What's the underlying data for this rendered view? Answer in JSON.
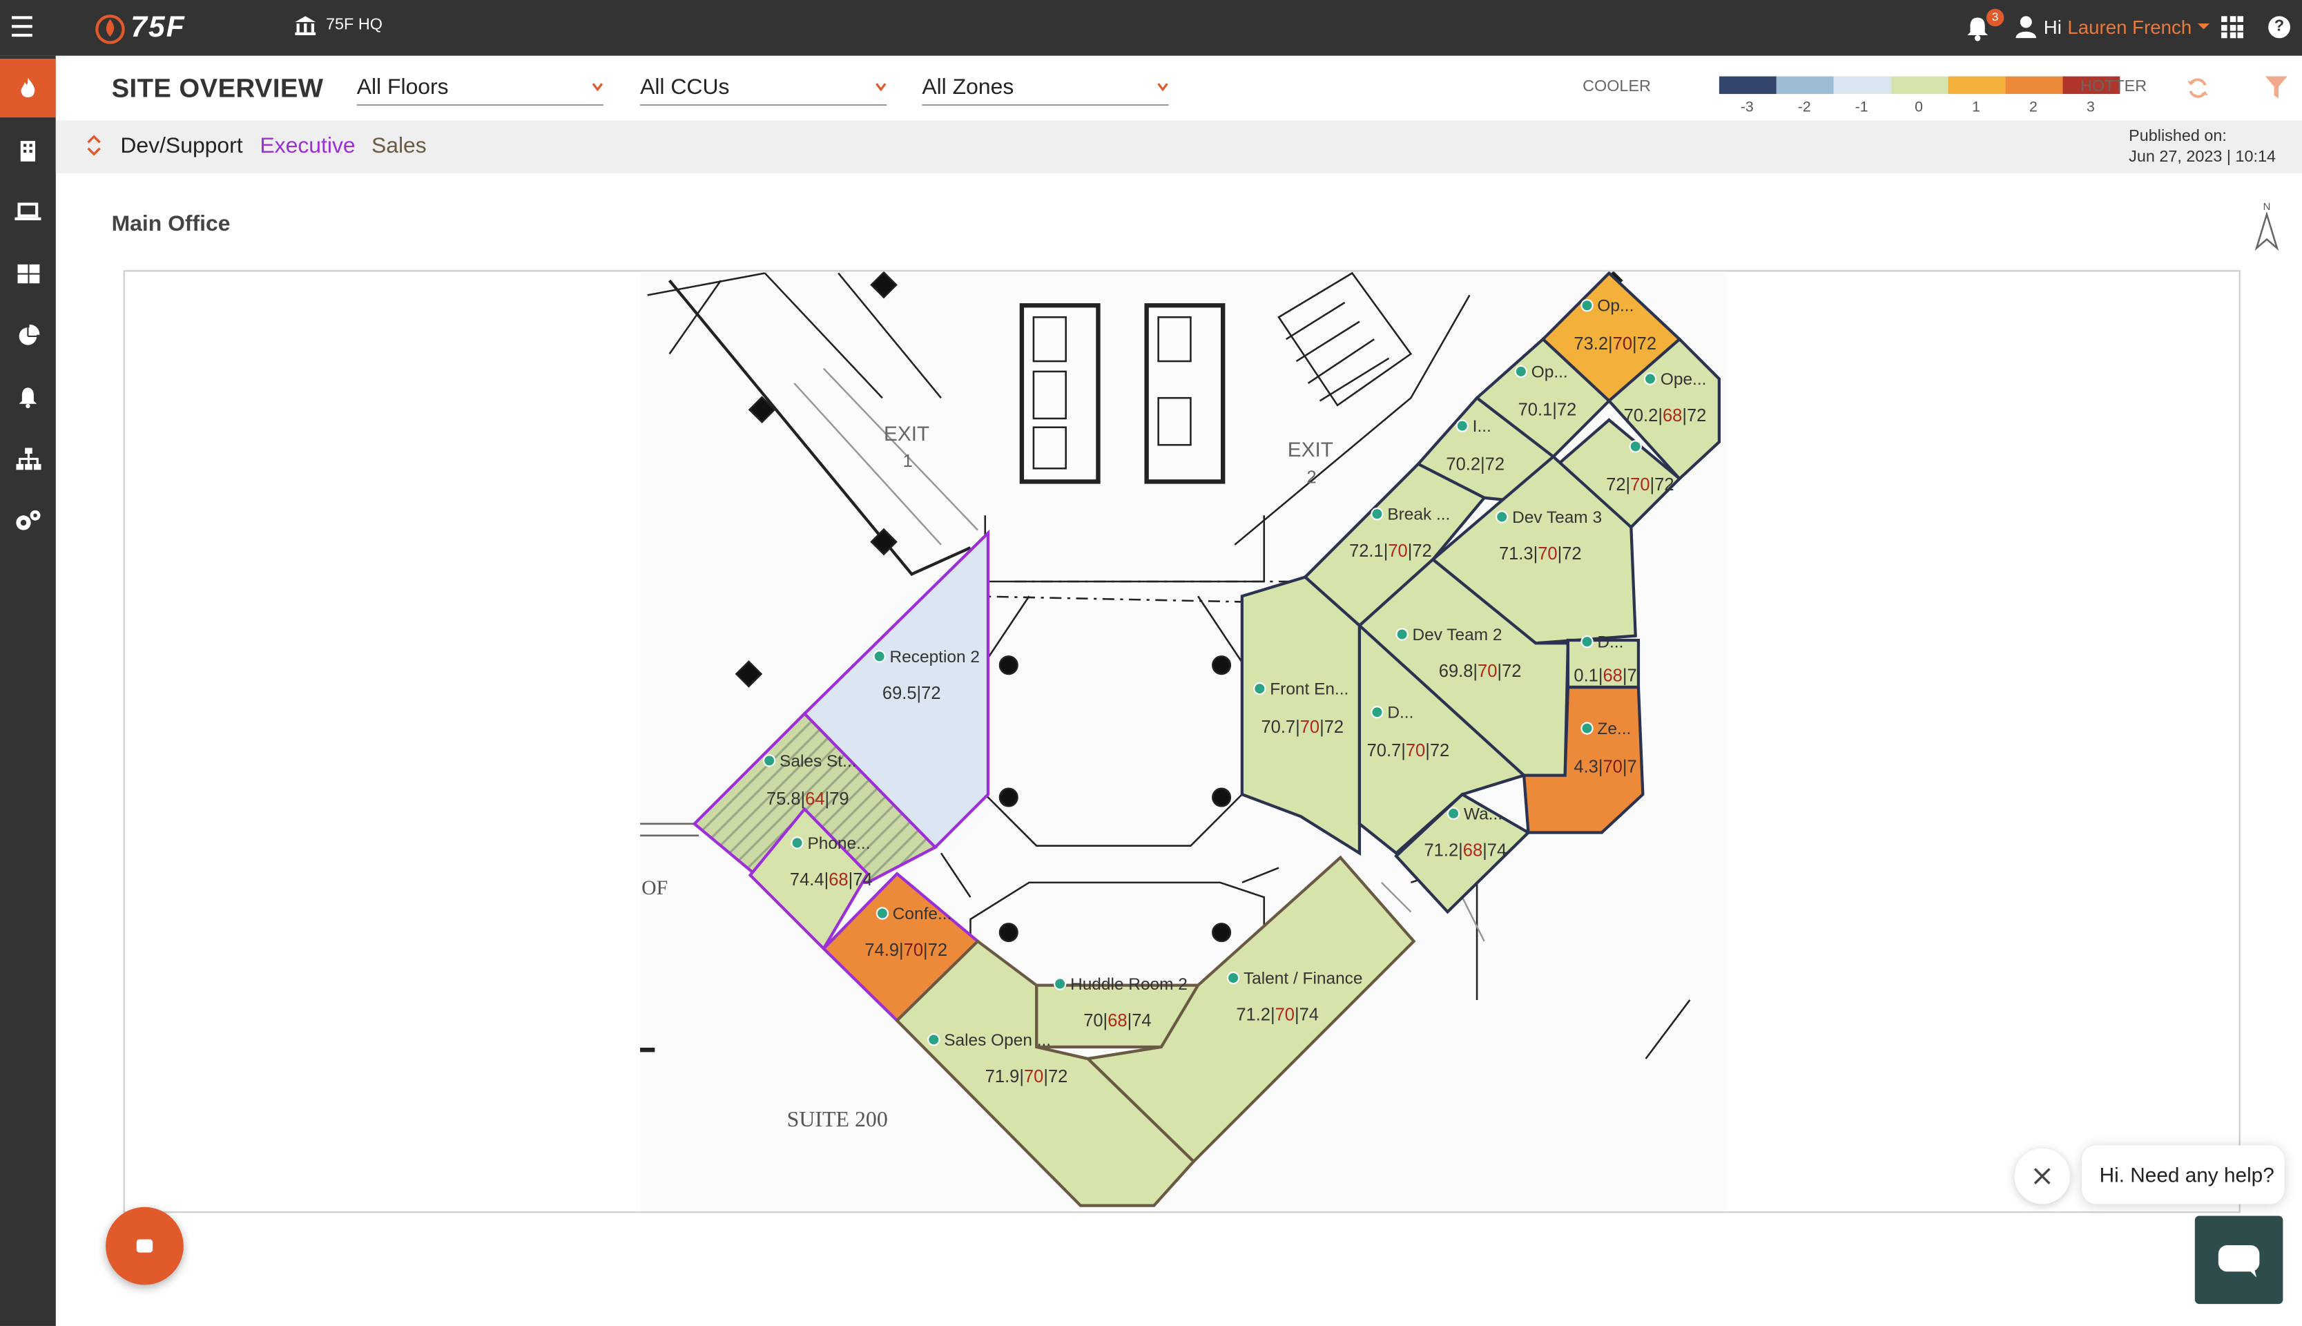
{
  "topbar": {
    "brand": "75F",
    "site_name": "75F HQ",
    "notifications_count": "3",
    "greeting": "Hi",
    "user_name": "Lauren French"
  },
  "header": {
    "title": "SITE OVERVIEW",
    "filters": [
      {
        "label": "All Floors"
      },
      {
        "label": "All CCUs"
      },
      {
        "label": "All Zones"
      }
    ]
  },
  "legend": {
    "cooler_label": "COOLER",
    "hotter_label": "HOTTER",
    "ticks": [
      "-3",
      "-2",
      "-1",
      "0",
      "1",
      "2",
      "3"
    ],
    "colors": [
      "#34456b",
      "#9dbcd6",
      "#d9e6f2",
      "#d6e4ab",
      "#f3b13c",
      "#ec8a3a",
      "#b0362c"
    ]
  },
  "subbar": {
    "tabs": [
      {
        "label": "Dev/Support",
        "color": "#222222"
      },
      {
        "label": "Executive",
        "color": "#9b30d9"
      },
      {
        "label": "Sales",
        "color": "#6b5a43"
      }
    ],
    "published_label": "Published on:",
    "published_date": "Jun 27, 2023 | 10:14"
  },
  "floor": {
    "name": "Main Office",
    "compass": "N",
    "suite_label": "SUITE 200",
    "exit1": "EXIT",
    "exit1_num": "1",
    "exit2": "EXIT",
    "exit2_num": "2",
    "of_label": "OF",
    "zones": [
      {
        "name": "Op...",
        "t1": "73.2",
        "t2": "70",
        "t3": "72"
      },
      {
        "name": "Op...",
        "t1": "70.1",
        "t3": "72"
      },
      {
        "name": "Ope...",
        "t1": "70.2",
        "t2": "68",
        "t3": "72"
      },
      {
        "name": "I...",
        "t1": "70.2",
        "t3": "72"
      },
      {
        "name": "",
        "t1": "72",
        "t2": "70",
        "t3": "72"
      },
      {
        "name": "Break ...",
        "t1": "72.1",
        "t2": "70",
        "t3": "72"
      },
      {
        "name": "Dev Team 3",
        "t1": "71.3",
        "t2": "70",
        "t3": "72"
      },
      {
        "name": "Dev Team 2",
        "t1": "69.8",
        "t2": "70",
        "t3": "72"
      },
      {
        "name": "D...",
        "t1": "0.1",
        "t2": "68",
        "t3": "7"
      },
      {
        "name": "Ze...",
        "t1": "4.3",
        "t2": "70",
        "t3": "7"
      },
      {
        "name": "Front En...",
        "t1": "70.7",
        "t2": "70",
        "t3": "72"
      },
      {
        "name": "D...",
        "t1": "70.7",
        "t2": "70",
        "t3": "72"
      },
      {
        "name": "Wa...",
        "t1": "71.2",
        "t2": "68",
        "t3": "74"
      },
      {
        "name": "Reception 2",
        "t1": "69.5",
        "t3": "72"
      },
      {
        "name": "Sales St...",
        "t1": "75.8",
        "t2": "64",
        "t3": "79"
      },
      {
        "name": "Phone...",
        "t1": "74.4",
        "t2": "68",
        "t3": "74"
      },
      {
        "name": "Confe...",
        "t1": "74.9",
        "t2": "70",
        "t3": "72"
      },
      {
        "name": "Huddle Room 2",
        "t1": "70",
        "t2": "68",
        "t3": "74"
      },
      {
        "name": "Talent / Finance",
        "t1": "71.2",
        "t2": "70",
        "t3": "74"
      },
      {
        "name": "Sales Open ...",
        "t1": "71.9",
        "t2": "70",
        "t3": "72"
      }
    ]
  },
  "chat": {
    "help_text": "Hi. Need any help?"
  }
}
